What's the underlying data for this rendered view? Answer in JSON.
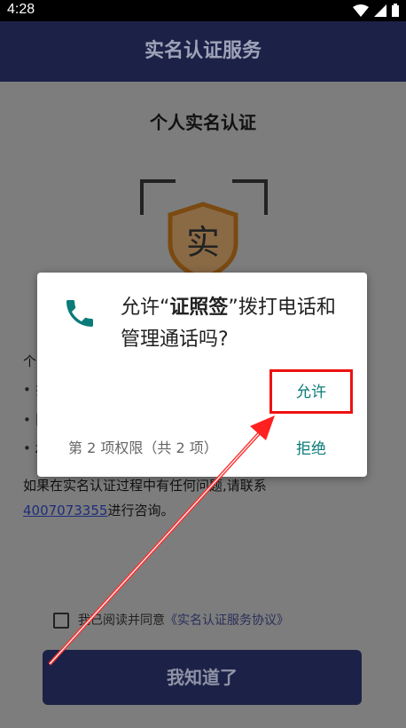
{
  "status": {
    "time": "4:28"
  },
  "appbar": {
    "title": "实名认证服务"
  },
  "main": {
    "heading": "个人实名认证",
    "shield_char": "实",
    "intro_partial": "个",
    "bullets": [
      "•  扌",
      "•  阝",
      "•  z"
    ],
    "contact_text_1": "如果在实名认证过程中有任何问题,请联系",
    "phone_number": "4007073355",
    "contact_text_2": "进行咨询。",
    "agree_prefix": "我已阅读并同意",
    "agree_link": "《实名认证服务协议》",
    "ok_button": "我知道了"
  },
  "dialog": {
    "title_prefix": "允许“",
    "app_name": "证照签",
    "title_suffix": "”拨打电话和管理通话吗?",
    "allow_label": "允许",
    "counter": "第 2 项权限（共 2 项）",
    "deny_label": "拒绝"
  },
  "colors": {
    "appbar": "#1c2247",
    "accent": "#0a7b78",
    "highlight": "#ee1111"
  }
}
